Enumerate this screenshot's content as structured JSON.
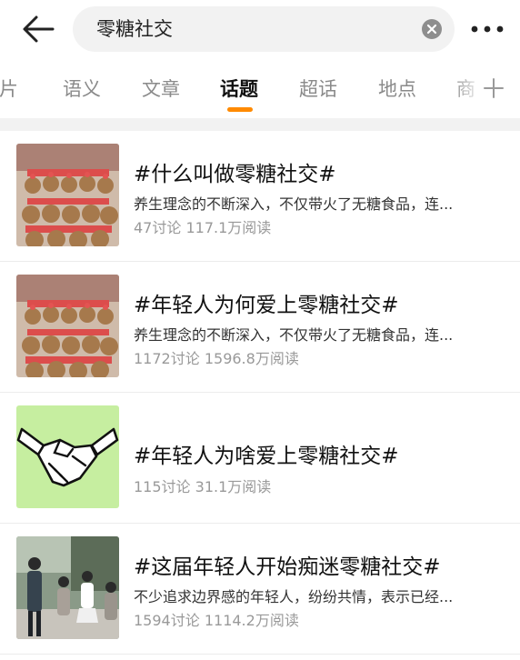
{
  "header": {
    "search_query": "零糖社交",
    "back_icon": "arrow-left-icon",
    "clear_icon": "close-circle-icon",
    "more_icon": "more-dots-icon"
  },
  "tabs": [
    {
      "label": "图片",
      "active": false
    },
    {
      "label": "语义",
      "active": false
    },
    {
      "label": "文章",
      "active": false
    },
    {
      "label": "话题",
      "active": true
    },
    {
      "label": "超话",
      "active": false
    },
    {
      "label": "地点",
      "active": false
    },
    {
      "label": "商",
      "active": false
    }
  ],
  "accent_color": "#ff8a00",
  "topics": [
    {
      "title": "#什么叫做零糖社交#",
      "description": "养生理念的不断深入，不仅带火了无糖食品，连...",
      "discussions": "47讨论",
      "reads": "117.1万阅读",
      "thumbnail": "plush-toys-display"
    },
    {
      "title": "#年轻人为何爱上零糖社交#",
      "description": "养生理念的不断深入，不仅带火了无糖食品，连...",
      "discussions": "1172讨论",
      "reads": "1596.8万阅读",
      "thumbnail": "plush-toys-display"
    },
    {
      "title": "#年轻人为啥爱上零糖社交#",
      "description": "",
      "discussions": "115讨论",
      "reads": "31.1万阅读",
      "thumbnail": "handshake-icon"
    },
    {
      "title": "#这届年轻人开始痴迷零糖社交#",
      "description": "不少追求边界感的年轻人，纷纷共情，表示已经...",
      "discussions": "1594讨论",
      "reads": "1114.2万阅读",
      "thumbnail": "people-photo"
    }
  ]
}
